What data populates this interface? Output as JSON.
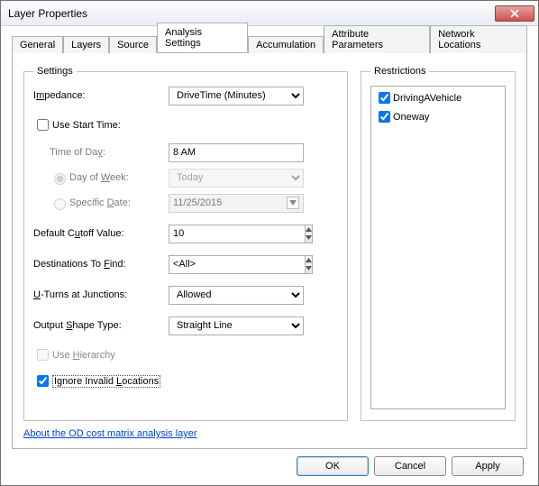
{
  "window": {
    "title": "Layer Properties"
  },
  "tabs": {
    "general": "General",
    "layers": "Layers",
    "source": "Source",
    "analysis": "Analysis Settings",
    "accumulation": "Accumulation",
    "attrparams": "Attribute Parameters",
    "netloc": "Network Locations"
  },
  "settings": {
    "legend": "Settings",
    "impedance_label_pre": "I",
    "impedance_label_u": "m",
    "impedance_label_post": "pedance:",
    "impedance_value": "DriveTime (Minutes)",
    "use_start_time_label": "Use Start Time:",
    "time_of_day_pre": "Time of Da",
    "time_of_day_u": "y",
    "time_of_day_post": ":",
    "time_of_day_value": "8 AM",
    "day_of_week_pre": "Day of ",
    "day_of_week_u": "W",
    "day_of_week_post": "eek:",
    "day_of_week_value": "Today",
    "specific_date_pre": "Specific ",
    "specific_date_u": "D",
    "specific_date_post": "ate:",
    "specific_date_value": "11/25/2015",
    "cutoff_pre": "Default C",
    "cutoff_u": "u",
    "cutoff_post": "toff Value:",
    "cutoff_value": "10",
    "dest_pre": "Destinations To ",
    "dest_u": "F",
    "dest_post": "ind:",
    "dest_value": "<All>",
    "uturn_pre": "",
    "uturn_u": "U",
    "uturn_post": "-Turns at Junctions:",
    "uturn_value": "Allowed",
    "shape_pre": "Output ",
    "shape_u": "S",
    "shape_post": "hape Type:",
    "shape_value": "Straight Line",
    "use_hierarchy_pre": "Use ",
    "use_hierarchy_u": "H",
    "use_hierarchy_post": "ierarchy",
    "ignore_pre": "Ignore Invalid ",
    "ignore_u": "L",
    "ignore_post": "ocations"
  },
  "restrictions": {
    "legend": "Restrictions",
    "items": [
      {
        "label": "DrivingAVehicle",
        "checked": true
      },
      {
        "label": "Oneway",
        "checked": true
      }
    ]
  },
  "link": {
    "text": "About the OD cost matrix analysis layer"
  },
  "buttons": {
    "ok": "OK",
    "cancel": "Cancel",
    "apply": "Apply"
  }
}
